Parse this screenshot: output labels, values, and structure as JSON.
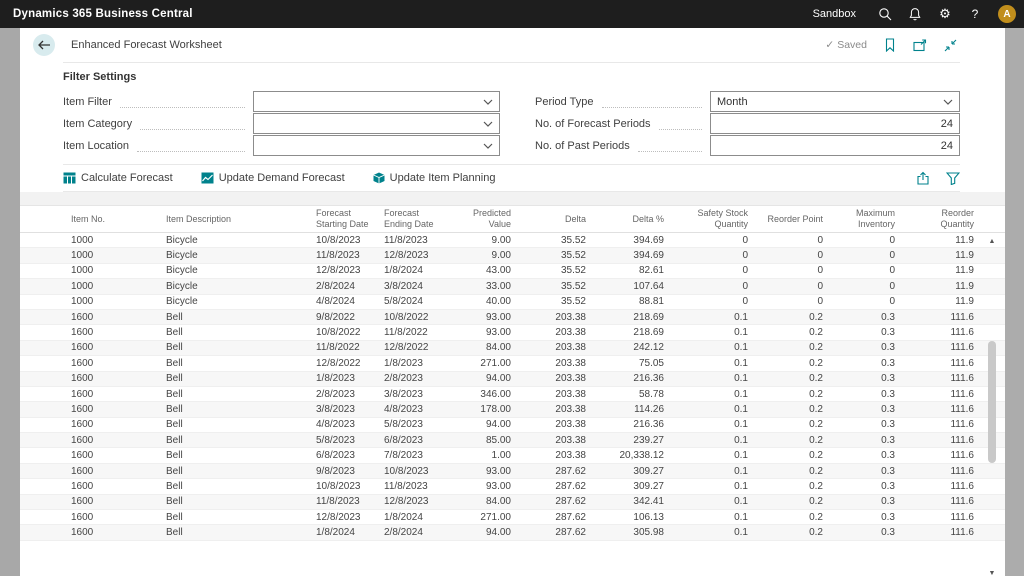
{
  "topbar": {
    "title": "Dynamics 365 Business Central",
    "environment": "Sandbox",
    "help_label": "?",
    "avatar_initial": "A"
  },
  "page": {
    "title": "Enhanced Forecast Worksheet",
    "saved_check": "✓",
    "saved_label": "Saved"
  },
  "filters": {
    "heading": "Filter Settings",
    "left": [
      {
        "label": "Item Filter",
        "value": "",
        "type": "dropdown"
      },
      {
        "label": "Item Category",
        "value": "",
        "type": "dropdown"
      },
      {
        "label": "Item Location",
        "value": "",
        "type": "dropdown"
      }
    ],
    "right": [
      {
        "label": "Period Type",
        "value": "Month",
        "type": "dropdown"
      },
      {
        "label": "No. of Forecast Periods",
        "value": "24",
        "type": "number"
      },
      {
        "label": "No. of Past Periods",
        "value": "24",
        "type": "number"
      }
    ]
  },
  "actions": [
    {
      "label": "Calculate Forecast",
      "icon": "calculate-forecast-icon"
    },
    {
      "label": "Update Demand Forecast",
      "icon": "update-demand-forecast-icon"
    },
    {
      "label": "Update Item Planning",
      "icon": "update-item-planning-icon"
    }
  ],
  "table": {
    "columns": [
      {
        "label": "Item No.",
        "align": "left"
      },
      {
        "label": "Item Description",
        "align": "left"
      },
      {
        "label": "Forecast Starting Date",
        "align": "left"
      },
      {
        "label": "Forecast Ending Date",
        "align": "left"
      },
      {
        "label": "Predicted Value",
        "align": "right"
      },
      {
        "label": "Delta",
        "align": "right"
      },
      {
        "label": "Delta %",
        "align": "right"
      },
      {
        "label": "Safety Stock Quantity",
        "align": "right"
      },
      {
        "label": "Reorder Point",
        "align": "right"
      },
      {
        "label": "Maximum Inventory",
        "align": "right"
      },
      {
        "label": "Reorder Quantity",
        "align": "right"
      }
    ],
    "rows": [
      [
        "1000",
        "Bicycle",
        "10/8/2023",
        "11/8/2023",
        "9.00",
        "35.52",
        "394.69",
        "0",
        "0",
        "0",
        "11.9"
      ],
      [
        "1000",
        "Bicycle",
        "11/8/2023",
        "12/8/2023",
        "9.00",
        "35.52",
        "394.69",
        "0",
        "0",
        "0",
        "11.9"
      ],
      [
        "1000",
        "Bicycle",
        "12/8/2023",
        "1/8/2024",
        "43.00",
        "35.52",
        "82.61",
        "0",
        "0",
        "0",
        "11.9"
      ],
      [
        "1000",
        "Bicycle",
        "2/8/2024",
        "3/8/2024",
        "33.00",
        "35.52",
        "107.64",
        "0",
        "0",
        "0",
        "11.9"
      ],
      [
        "1000",
        "Bicycle",
        "4/8/2024",
        "5/8/2024",
        "40.00",
        "35.52",
        "88.81",
        "0",
        "0",
        "0",
        "11.9"
      ],
      [
        "1600",
        "Bell",
        "9/8/2022",
        "10/8/2022",
        "93.00",
        "203.38",
        "218.69",
        "0.1",
        "0.2",
        "0.3",
        "111.6"
      ],
      [
        "1600",
        "Bell",
        "10/8/2022",
        "11/8/2022",
        "93.00",
        "203.38",
        "218.69",
        "0.1",
        "0.2",
        "0.3",
        "111.6"
      ],
      [
        "1600",
        "Bell",
        "11/8/2022",
        "12/8/2022",
        "84.00",
        "203.38",
        "242.12",
        "0.1",
        "0.2",
        "0.3",
        "111.6"
      ],
      [
        "1600",
        "Bell",
        "12/8/2022",
        "1/8/2023",
        "271.00",
        "203.38",
        "75.05",
        "0.1",
        "0.2",
        "0.3",
        "111.6"
      ],
      [
        "1600",
        "Bell",
        "1/8/2023",
        "2/8/2023",
        "94.00",
        "203.38",
        "216.36",
        "0.1",
        "0.2",
        "0.3",
        "111.6"
      ],
      [
        "1600",
        "Bell",
        "2/8/2023",
        "3/8/2023",
        "346.00",
        "203.38",
        "58.78",
        "0.1",
        "0.2",
        "0.3",
        "111.6"
      ],
      [
        "1600",
        "Bell",
        "3/8/2023",
        "4/8/2023",
        "178.00",
        "203.38",
        "114.26",
        "0.1",
        "0.2",
        "0.3",
        "111.6"
      ],
      [
        "1600",
        "Bell",
        "4/8/2023",
        "5/8/2023",
        "94.00",
        "203.38",
        "216.36",
        "0.1",
        "0.2",
        "0.3",
        "111.6"
      ],
      [
        "1600",
        "Bell",
        "5/8/2023",
        "6/8/2023",
        "85.00",
        "203.38",
        "239.27",
        "0.1",
        "0.2",
        "0.3",
        "111.6"
      ],
      [
        "1600",
        "Bell",
        "6/8/2023",
        "7/8/2023",
        "1.00",
        "203.38",
        "20,338.12",
        "0.1",
        "0.2",
        "0.3",
        "111.6"
      ],
      [
        "1600",
        "Bell",
        "9/8/2023",
        "10/8/2023",
        "93.00",
        "287.62",
        "309.27",
        "0.1",
        "0.2",
        "0.3",
        "111.6"
      ],
      [
        "1600",
        "Bell",
        "10/8/2023",
        "11/8/2023",
        "93.00",
        "287.62",
        "309.27",
        "0.1",
        "0.2",
        "0.3",
        "111.6"
      ],
      [
        "1600",
        "Bell",
        "11/8/2023",
        "12/8/2023",
        "84.00",
        "287.62",
        "342.41",
        "0.1",
        "0.2",
        "0.3",
        "111.6"
      ],
      [
        "1600",
        "Bell",
        "12/8/2023",
        "1/8/2024",
        "271.00",
        "287.62",
        "106.13",
        "0.1",
        "0.2",
        "0.3",
        "111.6"
      ],
      [
        "1600",
        "Bell",
        "1/8/2024",
        "2/8/2024",
        "94.00",
        "287.62",
        "305.98",
        "0.1",
        "0.2",
        "0.3",
        "111.6"
      ]
    ]
  },
  "colors": {
    "topbar_bg": "#1E1E1E",
    "accent_teal": "#00828C",
    "avatar_bg": "#C18E1C",
    "back_button_bg": "#D8EBEE",
    "side_strip_gray": "#A8A8A8",
    "row_stripe": "#F7F7F7"
  }
}
